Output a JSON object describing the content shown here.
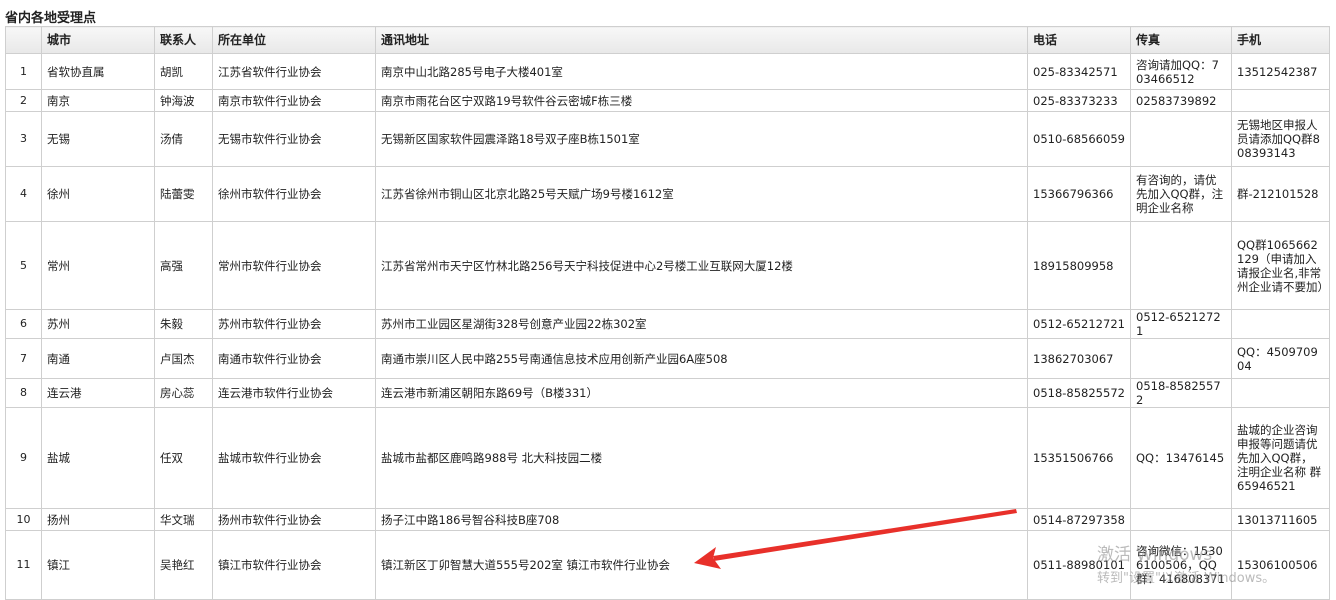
{
  "title": "省内各地受理点",
  "columns": [
    "",
    "城市",
    "联系人",
    "所在单位",
    "通讯地址",
    "电话",
    "传真",
    "手机"
  ],
  "rows": [
    {
      "no": "1",
      "city": "省软协直属",
      "contact": "胡凯",
      "org": "江苏省软件行业协会",
      "addr": "南京中山北路285号电子大楼401室",
      "phone": "025-83342571",
      "fax": "咨询请加QQ：703466512",
      "mobile": "13512542387"
    },
    {
      "no": "2",
      "city": "南京",
      "contact": "钟海波",
      "org": "南京市软件行业协会",
      "addr": "南京市雨花台区宁双路19号软件谷云密城F栋三楼",
      "phone": "025-83373233",
      "fax": "02583739892",
      "mobile": ""
    },
    {
      "no": "3",
      "city": "无锡",
      "contact": "汤倩",
      "org": "无锡市软件行业协会",
      "addr": "无锡新区国家软件园震泽路18号双子座B栋1501室",
      "phone": "0510-68566059",
      "fax": "",
      "mobile": "无锡地区申报人员请添加QQ群808393143"
    },
    {
      "no": "4",
      "city": "徐州",
      "contact": "陆蕾雯",
      "org": "徐州市软件行业协会",
      "addr": "江苏省徐州市铜山区北京北路25号天赋广场9号楼1612室",
      "phone": "15366796366",
      "fax": "有咨询的，请优先加入QQ群，注明企业名称",
      "mobile": "群-212101528"
    },
    {
      "no": "5",
      "city": "常州",
      "contact": "高强",
      "org": "常州市软件行业协会",
      "addr": "江苏省常州市天宁区竹林北路256号天宁科技促进中心2号楼工业互联网大厦12楼",
      "phone": "18915809958",
      "fax": "",
      "mobile": "QQ群1065662129（申请加入请报企业名,非常州企业请不要加）"
    },
    {
      "no": "6",
      "city": "苏州",
      "contact": "朱毅",
      "org": "苏州市软件行业协会",
      "addr": "苏州市工业园区星湖街328号创意产业园22栋302室",
      "phone": "0512-65212721",
      "fax": "0512-65212721",
      "mobile": ""
    },
    {
      "no": "7",
      "city": "南通",
      "contact": "卢国杰",
      "org": "南通市软件行业协会",
      "addr": "南通市崇川区人民中路255号南通信息技术应用创新产业园6A座508",
      "phone": "13862703067",
      "fax": "",
      "mobile": "QQ：450970904"
    },
    {
      "no": "8",
      "city": "连云港",
      "contact": "房心蕊",
      "org": "连云港市软件行业协会",
      "addr": "连云港市新浦区朝阳东路69号（B楼331）",
      "phone": "0518-85825572",
      "fax": "0518-85825572",
      "mobile": ""
    },
    {
      "no": "9",
      "city": "盐城",
      "contact": "任双",
      "org": "盐城市软件行业协会",
      "addr": "盐城市盐都区鹿鸣路988号 北大科技园二楼",
      "phone": "15351506766",
      "fax": "QQ：13476145",
      "mobile": "盐城的企业咨询申报等问题请优先加入QQ群，注明企业名称 群65946521"
    },
    {
      "no": "10",
      "city": "扬州",
      "contact": "华文瑞",
      "org": "扬州市软件行业协会",
      "addr": "扬子江中路186号智谷科技B座708",
      "phone": "0514-87297358",
      "fax": "",
      "mobile": "13013711605"
    },
    {
      "no": "11",
      "city": "镇江",
      "contact": "吴艳红",
      "org": "镇江市软件行业协会",
      "addr": "镇江新区丁卯智慧大道555号202室 镇江市软件行业协会",
      "phone": "0511-88980101",
      "fax": "咨询微信：15306100506，QQ群：416808371",
      "mobile": "15306100506"
    }
  ],
  "watermark": {
    "line1": "激活 Windows",
    "line2": "转到\"设置\"以激活 Windows。"
  },
  "colors": {
    "arrow": "#e8302a",
    "border": "#cfcfcf",
    "header_bg": "#ececec"
  }
}
